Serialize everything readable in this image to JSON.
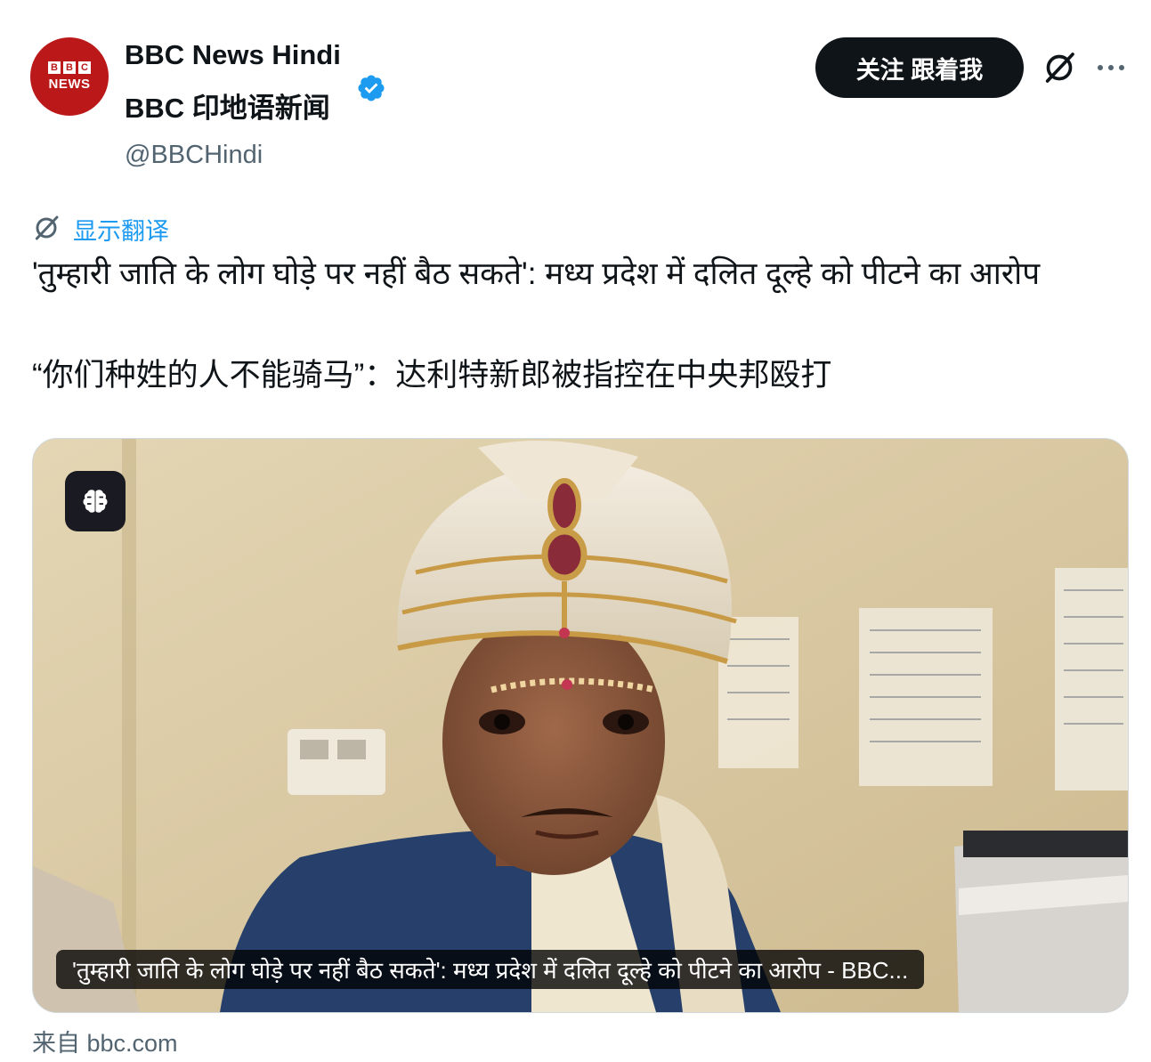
{
  "header": {
    "display_name": "BBC News Hindi",
    "display_name_translated": "BBC 印地语新闻",
    "handle": "@BBCHindi",
    "avatar": {
      "blocks": [
        "B",
        "B",
        "C"
      ],
      "word": "NEWS"
    },
    "follow_label": "关注 跟着我",
    "icons": {
      "verified": "verified-badge-icon",
      "grok": "grok-icon",
      "more": "more-options-icon"
    }
  },
  "translate": {
    "label": "显示翻译"
  },
  "tweet": {
    "text_hindi": "'तुम्हारी जाति के लोग घोड़े पर नहीं बैठ सकते': मध्य प्रदेश में दलित दूल्हे को पीटने का आरोप",
    "text_translated": "“你们种姓的人不能骑马”：达利特新郎被指控在中央邦殴打"
  },
  "card": {
    "title": "'तुम्हारी जाति के लोग घोड़े पर नहीं बैठ सकते': मध्य प्रदेश में दलित दूल्हे को पीटने का आरोप - BBC...",
    "source": "来自 bbc.com"
  },
  "colors": {
    "accent": "#1d9bf0",
    "text": "#0f1419",
    "muted": "#536471",
    "bbc_red": "#bb1919"
  }
}
